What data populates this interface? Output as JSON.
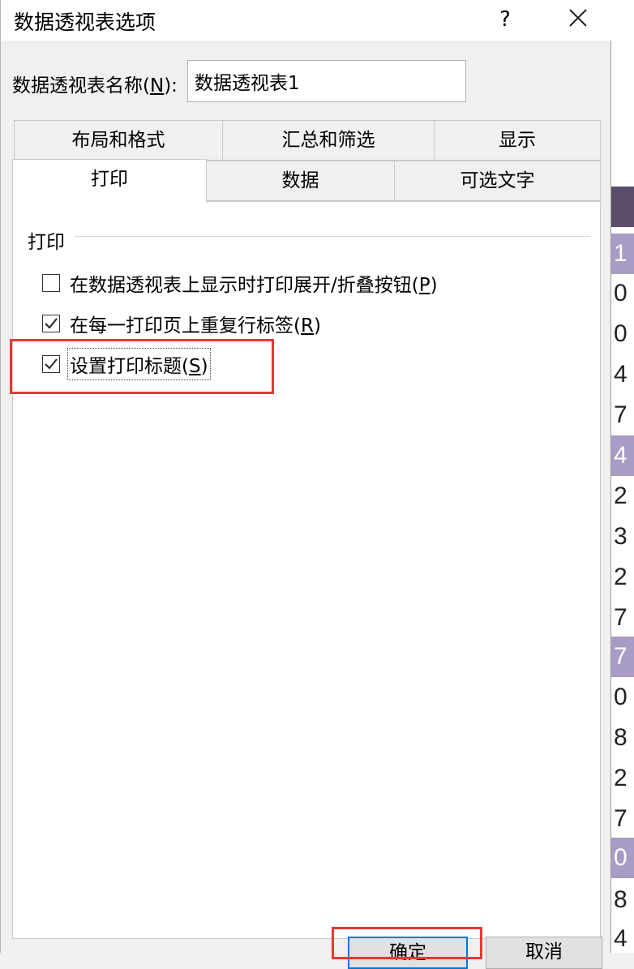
{
  "dialog": {
    "title": "数据透视表选项",
    "help_label": "?",
    "name_label_prefix": "数据透视表名称(",
    "name_label_key": "N",
    "name_label_suffix": "):",
    "name_value": "数据透视表1"
  },
  "tabs": {
    "row1": [
      {
        "label": "布局和格式"
      },
      {
        "label": "汇总和筛选"
      },
      {
        "label": "显示"
      }
    ],
    "row2": [
      {
        "label": "打印",
        "active": true
      },
      {
        "label": "数据"
      },
      {
        "label": "可选文字"
      }
    ]
  },
  "print_section": {
    "group_label": "打印",
    "options": [
      {
        "text": "在数据透视表上显示时打印展开/折叠按钮(",
        "key": "P",
        "suffix": ")",
        "checked": false
      },
      {
        "text": "在每一打印页上重复行标签(",
        "key": "R",
        "suffix": ")",
        "checked": true
      },
      {
        "text": "设置打印标题(",
        "key": "S",
        "suffix": ")",
        "checked": true
      }
    ]
  },
  "buttons": {
    "ok_label": "确定",
    "cancel_label": "取消"
  },
  "background_sheet": {
    "digits": [
      "1",
      "0",
      "0",
      "4",
      "7",
      "4",
      "2",
      "3",
      "2",
      "7",
      "7",
      "0",
      "8",
      "2",
      "7",
      "0",
      "8",
      "4"
    ]
  },
  "colors": {
    "highlight_red": "#e53935",
    "focus_blue": "#0078d7",
    "sheet_header": "#5a4e6c",
    "sheet_highlight": "#a89cc6"
  }
}
